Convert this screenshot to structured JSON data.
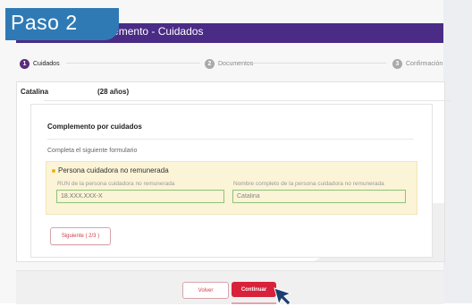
{
  "tag": {
    "text": "Paso 2"
  },
  "header": {
    "title": "Solicitud de Complemento - Cuidados"
  },
  "stepper": {
    "steps": [
      {
        "num": "1",
        "label": "Cuidados"
      },
      {
        "num": "2",
        "label": "Documentos"
      },
      {
        "num": "3",
        "label": "Confirmación"
      }
    ]
  },
  "person": {
    "name": "Catalina",
    "age": "(28 años)"
  },
  "form": {
    "title": "Complemento por cuidados",
    "subtitle": "Completa el siguiente formulario",
    "section": "Persona cuidadora no remunerada",
    "run_label": "RUN de la persona cuidadora no remunerada",
    "run_placeholder": "18.XXX.XXX-X",
    "name_label": "Nombre completo de la persona cuidadora no remunerada",
    "name_value": "Catalina",
    "next_label": "Siguiente ( 2/3 )"
  },
  "footer": {
    "back_label": "Volver",
    "continue_label": "Continuar"
  },
  "colors": {
    "header": "#4a2b86",
    "tag": "#2f7ab5",
    "accent": "#d8213a",
    "step_active": "#5a2b7d"
  }
}
